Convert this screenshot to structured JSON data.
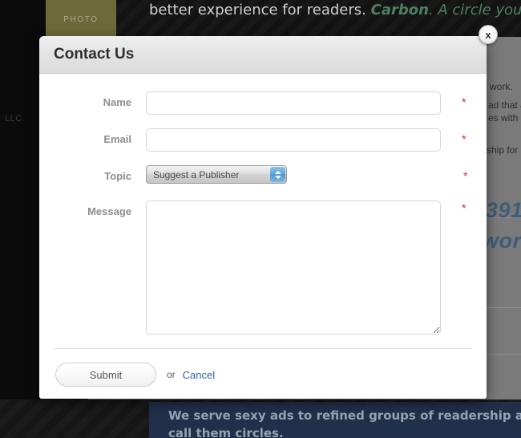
{
  "background": {
    "photo_tile_label": "PHOTO",
    "headline_lead": "better experience for readers. ",
    "headline_brand": "Carbon",
    "headline_tail": ". A circle you want to be",
    "left_footer": "LLC.",
    "fragments": [
      "work.",
      "ad that a",
      "es with",
      "ship for p"
    ],
    "stat_number": "391",
    "stat_word": "work",
    "banner_line1": "We serve sexy ads to refined groups of readership and",
    "banner_line2": "call them circles.",
    "colors": {
      "brand_green": "#4e7f61",
      "photo_tile": "#6d6a39",
      "banner_blue": "#20304a",
      "stat_blue": "#3f5d78"
    }
  },
  "dialog": {
    "title": "Contact Us",
    "close_label": "x",
    "close_icon": "close-icon",
    "required_marker": "*",
    "fields": {
      "name": {
        "label": "Name",
        "value": "",
        "placeholder": ""
      },
      "email": {
        "label": "Email",
        "value": "",
        "placeholder": ""
      },
      "topic": {
        "label": "Topic",
        "selected": "Suggest a Publisher",
        "options": [
          "Suggest a Publisher"
        ]
      },
      "message": {
        "label": "Message",
        "value": "",
        "placeholder": ""
      }
    },
    "actions": {
      "submit_label": "Submit",
      "or_label": "or",
      "cancel_label": "Cancel",
      "cancel_color": "#2b64b5"
    }
  }
}
